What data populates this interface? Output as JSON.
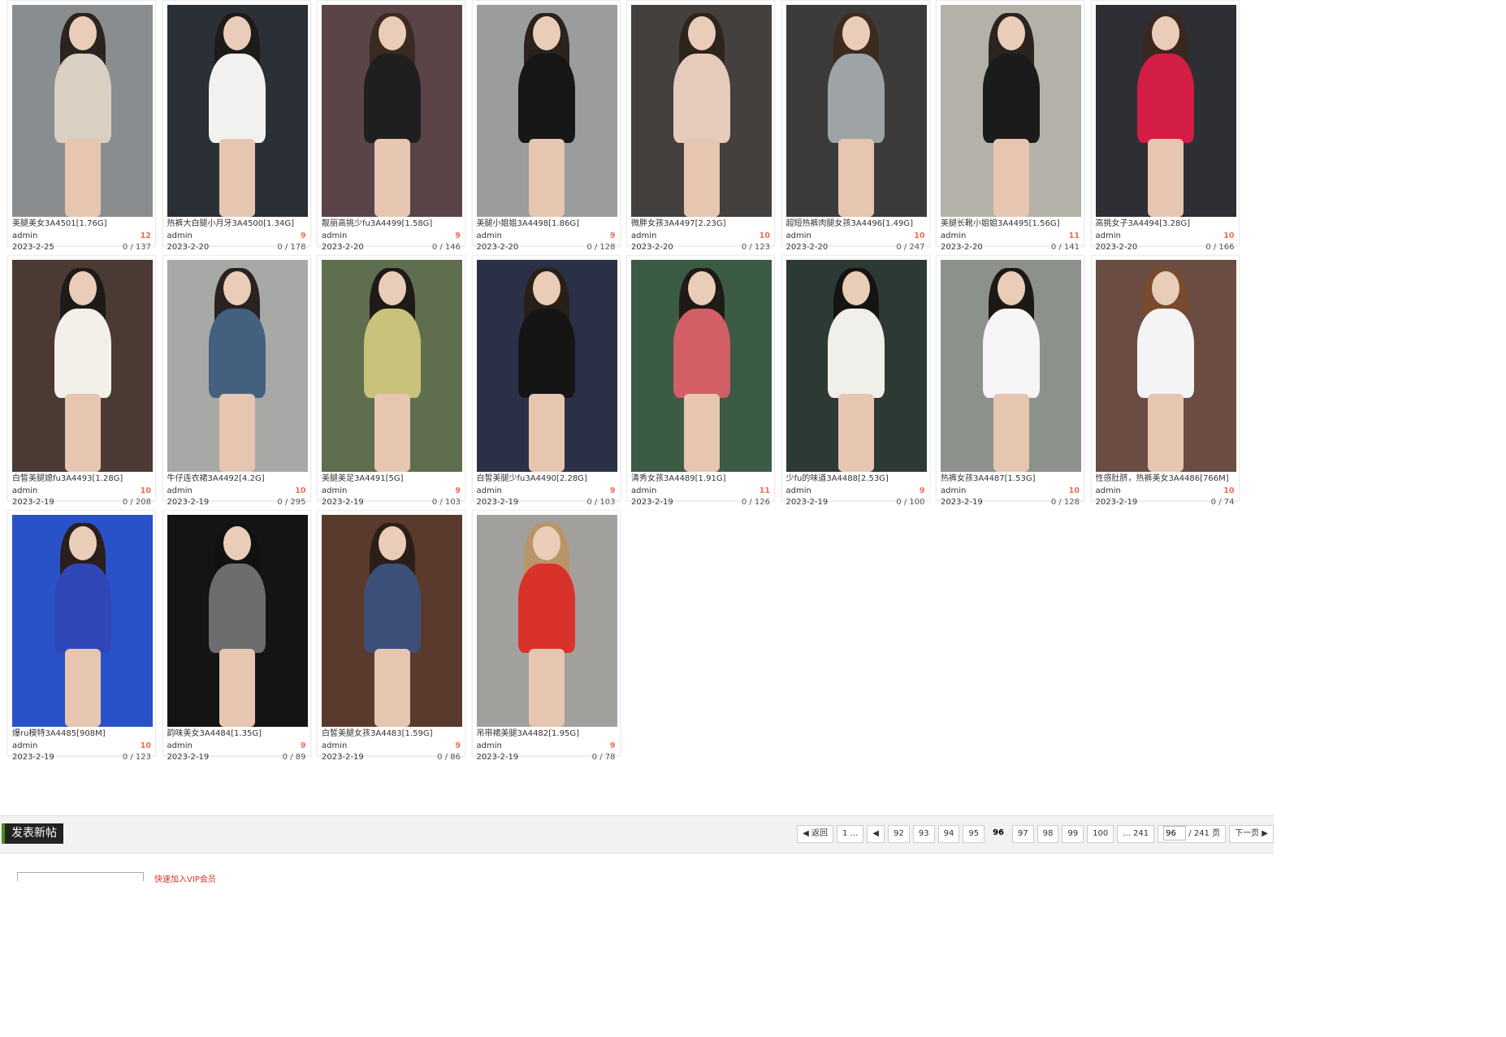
{
  "posts": [
    {
      "title": "美腿美女3A4501[1.76G]",
      "author": "admin",
      "replies": "12",
      "date": "2023-2-25",
      "stats": "0 / 137",
      "bg": "#8a8d90",
      "cloth": "#d9cfc3",
      "hair": "#2a2420"
    },
    {
      "title": "热裤大白腿小月牙3A4500[1.34G]",
      "author": "admin",
      "replies": "9",
      "date": "2023-2-20",
      "stats": "0 / 178",
      "bg": "#2b3036",
      "cloth": "#f1f1ef",
      "hair": "#1d1b1a"
    },
    {
      "title": "靓丽高挑少fu3A4499[1.58G]",
      "author": "admin",
      "replies": "9",
      "date": "2023-2-20",
      "stats": "0 / 146",
      "bg": "#5a4448",
      "cloth": "#1f1f1f",
      "hair": "#3a2a22"
    },
    {
      "title": "美腿小姐姐3A4498[1.86G]",
      "author": "admin",
      "replies": "9",
      "date": "2023-2-20",
      "stats": "0 / 128",
      "bg": "#9a9c9e",
      "cloth": "#161616",
      "hair": "#2a221c"
    },
    {
      "title": "微胖女孩3A4497[2.23G]",
      "author": "admin",
      "replies": "10",
      "date": "2023-2-20",
      "stats": "0 / 123",
      "bg": "#44403d",
      "cloth": "#e6cbbb",
      "hair": "#2e241e"
    },
    {
      "title": "超短热裤肉腿女孩3A4496[1.49G]",
      "author": "admin",
      "replies": "10",
      "date": "2023-2-20",
      "stats": "0 / 247",
      "bg": "#3a3b3a",
      "cloth": "#9ea3a6",
      "hair": "#3d2b20"
    },
    {
      "title": "美腿长靴小姐姐3A4495[1.56G]",
      "author": "admin",
      "replies": "11",
      "date": "2023-2-20",
      "stats": "0 / 141",
      "bg": "#b3b1a8",
      "cloth": "#1b1b1b",
      "hair": "#2a2320"
    },
    {
      "title": "高挑女子3A4494[3.28G]",
      "author": "admin",
      "replies": "10",
      "date": "2023-2-20",
      "stats": "0 / 166",
      "bg": "#2d2f35",
      "cloth": "#d41d44",
      "hair": "#3a2820"
    },
    {
      "title": "白皙美腿媳fu3A4493[1.28G]",
      "author": "admin",
      "replies": "10",
      "date": "2023-2-19",
      "stats": "0 / 208",
      "bg": "#4a3a33",
      "cloth": "#f3f0ea",
      "hair": "#1e1a18"
    },
    {
      "title": "牛仔连衣裙3A4492[4.2G]",
      "author": "admin",
      "replies": "10",
      "date": "2023-2-19",
      "stats": "0 / 295",
      "bg": "#a7a9a6",
      "cloth": "#44607f",
      "hair": "#2a2220"
    },
    {
      "title": "美腿美足3A4491[5G]",
      "author": "admin",
      "replies": "9",
      "date": "2023-2-19",
      "stats": "0 / 103",
      "bg": "#5f6e4e",
      "cloth": "#c9c27a",
      "hair": "#1e1a18"
    },
    {
      "title": "白皙美腿少fu3A4490[2.28G]",
      "author": "admin",
      "replies": "9",
      "date": "2023-2-19",
      "stats": "0 / 103",
      "bg": "#2a3046",
      "cloth": "#151515",
      "hair": "#2a1e18"
    },
    {
      "title": "清秀女孩3A4489[1.91G]",
      "author": "admin",
      "replies": "11",
      "date": "2023-2-19",
      "stats": "0 / 126",
      "bg": "#3c5b45",
      "cloth": "#d25f66",
      "hair": "#1f1a18"
    },
    {
      "title": "少fu的味道3A4488[2.53G]",
      "author": "admin",
      "replies": "9",
      "date": "2023-2-19",
      "stats": "0 / 100",
      "bg": "#2d3a33",
      "cloth": "#f1efea",
      "hair": "#161412"
    },
    {
      "title": "热裤女孩3A4487[1.53G]",
      "author": "admin",
      "replies": "10",
      "date": "2023-2-19",
      "stats": "0 / 128",
      "bg": "#8c918c",
      "cloth": "#f5f5f5",
      "hair": "#1c1816"
    },
    {
      "title": "性感肚脐，热裤美女3A4486[766M]",
      "author": "admin",
      "replies": "10",
      "date": "2023-2-19",
      "stats": "0 / 74",
      "bg": "#6b4c43",
      "cloth": "#f4f4f4",
      "hair": "#7a4a2c"
    },
    {
      "title": "爆ru模特3A4485[908M]",
      "author": "admin",
      "replies": "10",
      "date": "2023-2-19",
      "stats": "0 / 123",
      "bg": "#2a52c8",
      "cloth": "#2f47b6",
      "hair": "#2a1f1c"
    },
    {
      "title": "韵味美女3A4484[1.35G]",
      "author": "admin",
      "replies": "9",
      "date": "2023-2-19",
      "stats": "0 / 89",
      "bg": "#141414",
      "cloth": "#6c6d6f",
      "hair": "#111"
    },
    {
      "title": "白皙美腿女孩3A4483[1.59G]",
      "author": "admin",
      "replies": "9",
      "date": "2023-2-19",
      "stats": "0 / 86",
      "bg": "#5a3a2c",
      "cloth": "#3b4f78",
      "hair": "#2a1f18"
    },
    {
      "title": "吊带裙美腿3A4482[1.95G]",
      "author": "admin",
      "replies": "9",
      "date": "2023-2-19",
      "stats": "0 / 78",
      "bg": "#a1a09c",
      "cloth": "#d8322a",
      "hair": "#b89468"
    }
  ],
  "toolbar": {
    "new_post": "发表新帖"
  },
  "pager": {
    "prev": "返回",
    "first": "1 ...",
    "pages": [
      "92",
      "93",
      "94",
      "95",
      "96",
      "97",
      "98",
      "99",
      "100"
    ],
    "current": "96",
    "last": "... 241",
    "jump_value": "96",
    "total": "/ 241 页",
    "next": "下一页"
  },
  "footer": {
    "notice": "快速加入VIP会员"
  },
  "colors": {
    "reply": "#f26c4f",
    "accent": "#4a8d1a"
  }
}
